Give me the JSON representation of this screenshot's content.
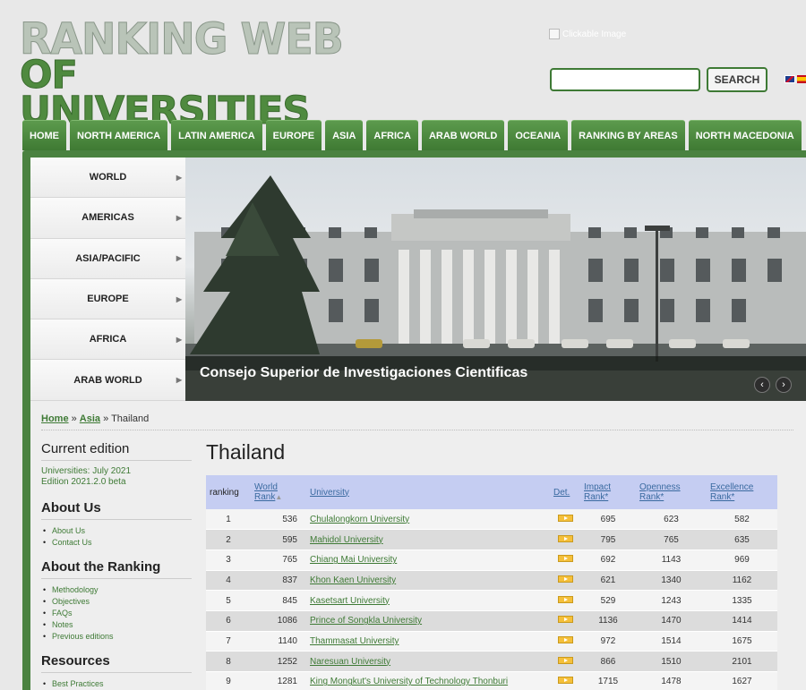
{
  "header": {
    "logo_line1": "RANKING WEB",
    "logo_line2": "OF UNIVERSITIES",
    "clickable_image_alt": "Clickable Image",
    "search_button": "SEARCH",
    "search_value": ""
  },
  "topnav": [
    "HOME",
    "NORTH AMERICA",
    "LATIN AMERICA",
    "EUROPE",
    "ASIA",
    "AFRICA",
    "ARAB WORLD",
    "OCEANIA",
    "RANKING BY AREAS",
    "NORTH MACEDONIA"
  ],
  "sidemenu": [
    "WORLD",
    "AMERICAS",
    "ASIA/PACIFIC",
    "EUROPE",
    "AFRICA",
    "ARAB WORLD"
  ],
  "banner": {
    "caption": "Consejo Superior de Investigaciones Cientificas",
    "prev": "‹",
    "next": "›"
  },
  "breadcrumb": {
    "home": "Home",
    "sep1": " » ",
    "asia": "Asia",
    "sep2": " » ",
    "current": "Thailand"
  },
  "sidebar": {
    "current_edition_title": "Current edition",
    "edition_line1": "Universities: July 2021",
    "edition_line2": "Edition 2021.2.0 beta",
    "about_us_title": "About Us",
    "about_us_items": [
      "About Us",
      "Contact Us"
    ],
    "about_ranking_title": "About the Ranking",
    "about_ranking_items": [
      "Methodology",
      "Objectives",
      "FAQs",
      "Notes",
      "Previous editions"
    ],
    "resources_title": "Resources",
    "resources_items": [
      "Best Practices"
    ]
  },
  "main": {
    "title": "Thailand",
    "columns": {
      "ranking": "ranking",
      "world_rank_1": "World",
      "world_rank_2": "Rank",
      "sort_arrow": "▲",
      "university": "University",
      "det": "Det.",
      "impact_1": "Impact",
      "impact_2": "Rank*",
      "openness_1": "Openness",
      "openness_2": "Rank*",
      "excellence_1": "Excellence",
      "excellence_2": "Rank*"
    },
    "rows": [
      {
        "ranking": "1",
        "world": "536",
        "university": "Chulalongkorn University",
        "impact": "695",
        "openness": "623",
        "excellence": "582"
      },
      {
        "ranking": "2",
        "world": "595",
        "university": "Mahidol University",
        "impact": "795",
        "openness": "765",
        "excellence": "635"
      },
      {
        "ranking": "3",
        "world": "765",
        "university": "Chiang Mai University",
        "impact": "692",
        "openness": "1143",
        "excellence": "969"
      },
      {
        "ranking": "4",
        "world": "837",
        "university": "Khon Kaen University",
        "impact": "621",
        "openness": "1340",
        "excellence": "1162"
      },
      {
        "ranking": "5",
        "world": "845",
        "university": "Kasetsart University",
        "impact": "529",
        "openness": "1243",
        "excellence": "1335"
      },
      {
        "ranking": "6",
        "world": "1086",
        "university": "Prince of Songkla University",
        "impact": "1136",
        "openness": "1470",
        "excellence": "1414"
      },
      {
        "ranking": "7",
        "world": "1140",
        "university": "Thammasat University",
        "impact": "972",
        "openness": "1514",
        "excellence": "1675"
      },
      {
        "ranking": "8",
        "world": "1252",
        "university": "Naresuan University",
        "impact": "866",
        "openness": "1510",
        "excellence": "2101"
      },
      {
        "ranking": "9",
        "world": "1281",
        "university": "King Mongkut's University of Technology Thonburi",
        "impact": "1715",
        "openness": "1478",
        "excellence": "1627"
      }
    ]
  },
  "colors": {
    "brand_green": "#4a8240",
    "link_green": "#3e7a35",
    "table_header": "#c5cdf2"
  }
}
